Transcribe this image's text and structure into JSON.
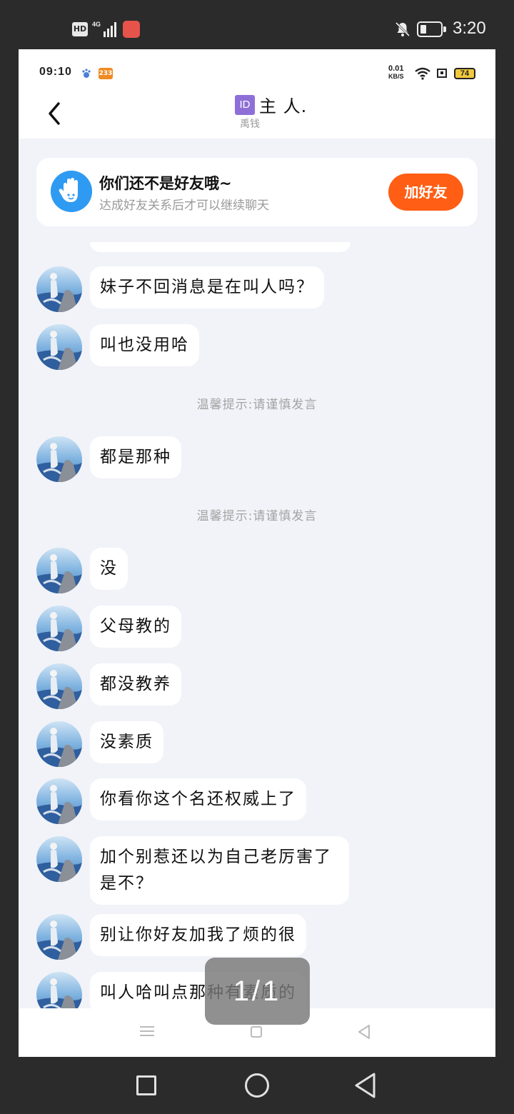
{
  "outer_status": {
    "hd": "HD",
    "time": "3:20"
  },
  "inner_status": {
    "time": "09:10",
    "badge": "233",
    "speed_value": "0.01",
    "speed_unit": "KB/S",
    "battery": "74"
  },
  "header": {
    "id_badge": "ID",
    "name": "主 人.",
    "subtitle": "禹钱"
  },
  "friend_card": {
    "title": "你们还不是好友哦~",
    "subtitle": "达成好友关系后才可以继续聊天",
    "button": "加好友"
  },
  "messages": [
    {
      "text": "妹子不回消息是在叫人吗？"
    },
    {
      "text": "叫也没用哈"
    },
    {
      "tip": "温馨提示:请谨慎发言"
    },
    {
      "text": "都是那种"
    },
    {
      "tip": "温馨提示:请谨慎发言"
    },
    {
      "text": "没"
    },
    {
      "text": "父母教的"
    },
    {
      "text": "都没教养"
    },
    {
      "text": "没素质"
    },
    {
      "text": "你看你这个名还权威上了"
    },
    {
      "text": "加个别惹还以为自己老厉害了是不？"
    },
    {
      "text": "别让你好友加我了烦的很"
    },
    {
      "text": "叫人哈叫点那种有素质的"
    }
  ],
  "page_indicator": "1/1",
  "colors": {
    "accent_button": "#ff5e14",
    "friend_icon": "#2f9af2",
    "chat_bg": "#f1f3f8",
    "id_badge": "#8e6fd8"
  }
}
